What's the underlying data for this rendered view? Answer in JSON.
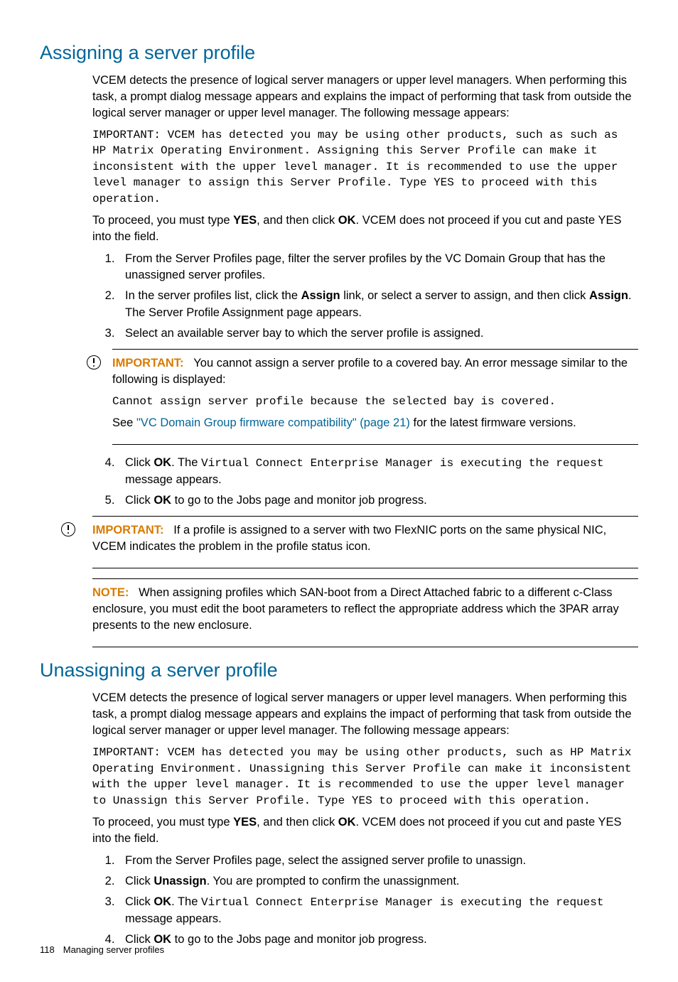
{
  "section1": {
    "title": "Assigning a server profile",
    "para1": "VCEM detects the presence of logical server managers or upper level managers. When performing this task, a prompt dialog message appears and explains the impact of performing that task from outside the logical server manager or upper level manager. The following message appears:",
    "code1": "IMPORTANT: VCEM has detected you may be using other products, such as such as HP Matrix Operating Environment. Assigning this Server Profile can make it inconsistent with the upper level manager. It is recommended to use the upper level manager to assign this Server Profile. Type YES to proceed with this operation.",
    "para2a": "To proceed, you must type ",
    "para2_yes": "YES",
    "para2b": ", and then click ",
    "para2_ok": "OK",
    "para2c": ". VCEM does not proceed if you cut and paste YES into the field.",
    "step1": "From the Server Profiles page, filter the server profiles by the VC Domain Group that has the unassigned server profiles.",
    "step2a": "In the server profiles list, click the ",
    "step2_assign": "Assign",
    "step2b": " link, or select a server to assign, and then click ",
    "step2_assign2": "Assign",
    "step2c": ". The Server Profile Assignment page appears.",
    "step3": "Select an available server bay to which the server profile is assigned.",
    "imp1_label": "IMPORTANT:",
    "imp1_text": "You cannot assign a server profile to a covered bay. An error message similar to the following is displayed:",
    "imp1_code": "Cannot assign server profile because the selected bay is covered.",
    "imp1_see": "See ",
    "imp1_link": "\"VC Domain Group firmware compatibility\" (page 21)",
    "imp1_after": " for the latest firmware versions.",
    "step4a": "Click ",
    "step4_ok": "OK",
    "step4b": ". The ",
    "step4_code": "Virtual Connect Enterprise Manager is executing the request",
    "step4c": " message appears.",
    "step5a": "Click ",
    "step5_ok": "OK",
    "step5b": " to go to the Jobs page and monitor job progress.",
    "imp2_label": "IMPORTANT:",
    "imp2_text": "If a profile is assigned to a server with two FlexNIC ports on the same physical NIC, VCEM indicates the problem in the profile status icon.",
    "note_label": "NOTE:",
    "note_text": "When assigning profiles which SAN-boot from a Direct Attached fabric to a different c-Class enclosure, you must edit the boot parameters to reflect the appropriate address which the 3PAR array presents to the new enclosure."
  },
  "section2": {
    "title": "Unassigning a server profile",
    "para1": "VCEM detects the presence of logical server managers or upper level managers. When performing this task, a prompt dialog message appears and explains the impact of performing that task from outside the logical server manager or upper level manager. The following message appears:",
    "code1": "IMPORTANT: VCEM has detected you may be using other products, such as HP Matrix Operating Environment. Unassigning this Server Profile can make it inconsistent with the upper level manager. It is recommended to use the upper level manager to Unassign this Server Profile. Type YES to proceed with this operation.",
    "para2a": "To proceed, you must type ",
    "para2_yes": "YES",
    "para2b": ", and then click ",
    "para2_ok": "OK",
    "para2c": ". VCEM does not proceed if you cut and paste YES into the field.",
    "step1": "From the Server Profiles page, select the assigned server profile to unassign.",
    "step2a": "Click ",
    "step2_unassign": "Unassign",
    "step2b": ". You are prompted to confirm the unassignment.",
    "step3a": "Click ",
    "step3_ok": "OK",
    "step3b": ". The ",
    "step3_code": "Virtual Connect Enterprise Manager is executing the request",
    "step3c": " message appears.",
    "step4a": "Click ",
    "step4_ok": "OK",
    "step4b": " to go to the Jobs page and monitor job progress."
  },
  "footer": {
    "page": "118",
    "title": "Managing server profiles"
  }
}
